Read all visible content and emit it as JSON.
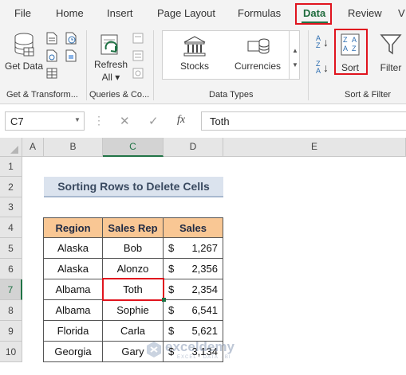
{
  "ribbon_tabs": [
    "File",
    "Home",
    "Insert",
    "Page Layout",
    "Formulas",
    "Data",
    "Review",
    "V"
  ],
  "active_tab": "Data",
  "groups": {
    "get_transform": {
      "label": "Get & Transform...",
      "get_data": "Get Data",
      "get_data_arrow": "Get\nData ▾"
    },
    "queries": {
      "label": "Queries & Co...",
      "refresh": "Refresh",
      "refresh_all": "All ▾"
    },
    "data_types": {
      "label": "Data Types",
      "stocks": "Stocks",
      "currencies": "Currencies"
    },
    "sort_filter": {
      "label": "Sort & Filter",
      "sort": "Sort",
      "filter": "Filter"
    }
  },
  "formula_bar": {
    "name_box": "C7",
    "fx": "fx",
    "value": "Toth"
  },
  "columns": [
    "A",
    "B",
    "C",
    "D",
    "E"
  ],
  "rows": [
    "1",
    "2",
    "3",
    "4",
    "5",
    "6",
    "7",
    "8",
    "9",
    "10"
  ],
  "sheet": {
    "title": "Sorting Rows to Delete Cells",
    "headers": [
      "Region",
      "Sales Rep",
      "Sales"
    ],
    "data": [
      {
        "region": "Alaska",
        "rep": "Bob",
        "cur": "$",
        "sales": "1,267"
      },
      {
        "region": "Alaska",
        "rep": "Alonzo",
        "cur": "$",
        "sales": "2,356"
      },
      {
        "region": "Albama",
        "rep": "Toth",
        "cur": "$",
        "sales": "2,354"
      },
      {
        "region": "Albama",
        "rep": "Sophie",
        "cur": "$",
        "sales": "6,541"
      },
      {
        "region": "Florida",
        "rep": "Carla",
        "cur": "$",
        "sales": "5,621"
      },
      {
        "region": "Georgia",
        "rep": "Gary",
        "cur": "$",
        "sales": "3,134"
      }
    ]
  },
  "watermark": {
    "name": "exceldemy",
    "tagline": "EXCEL · DATA · BI"
  },
  "colors": {
    "highlight": "#e0141e",
    "header_fill": "#f9c794",
    "title_fill": "#dbe3ee",
    "excel_green": "#217346"
  }
}
